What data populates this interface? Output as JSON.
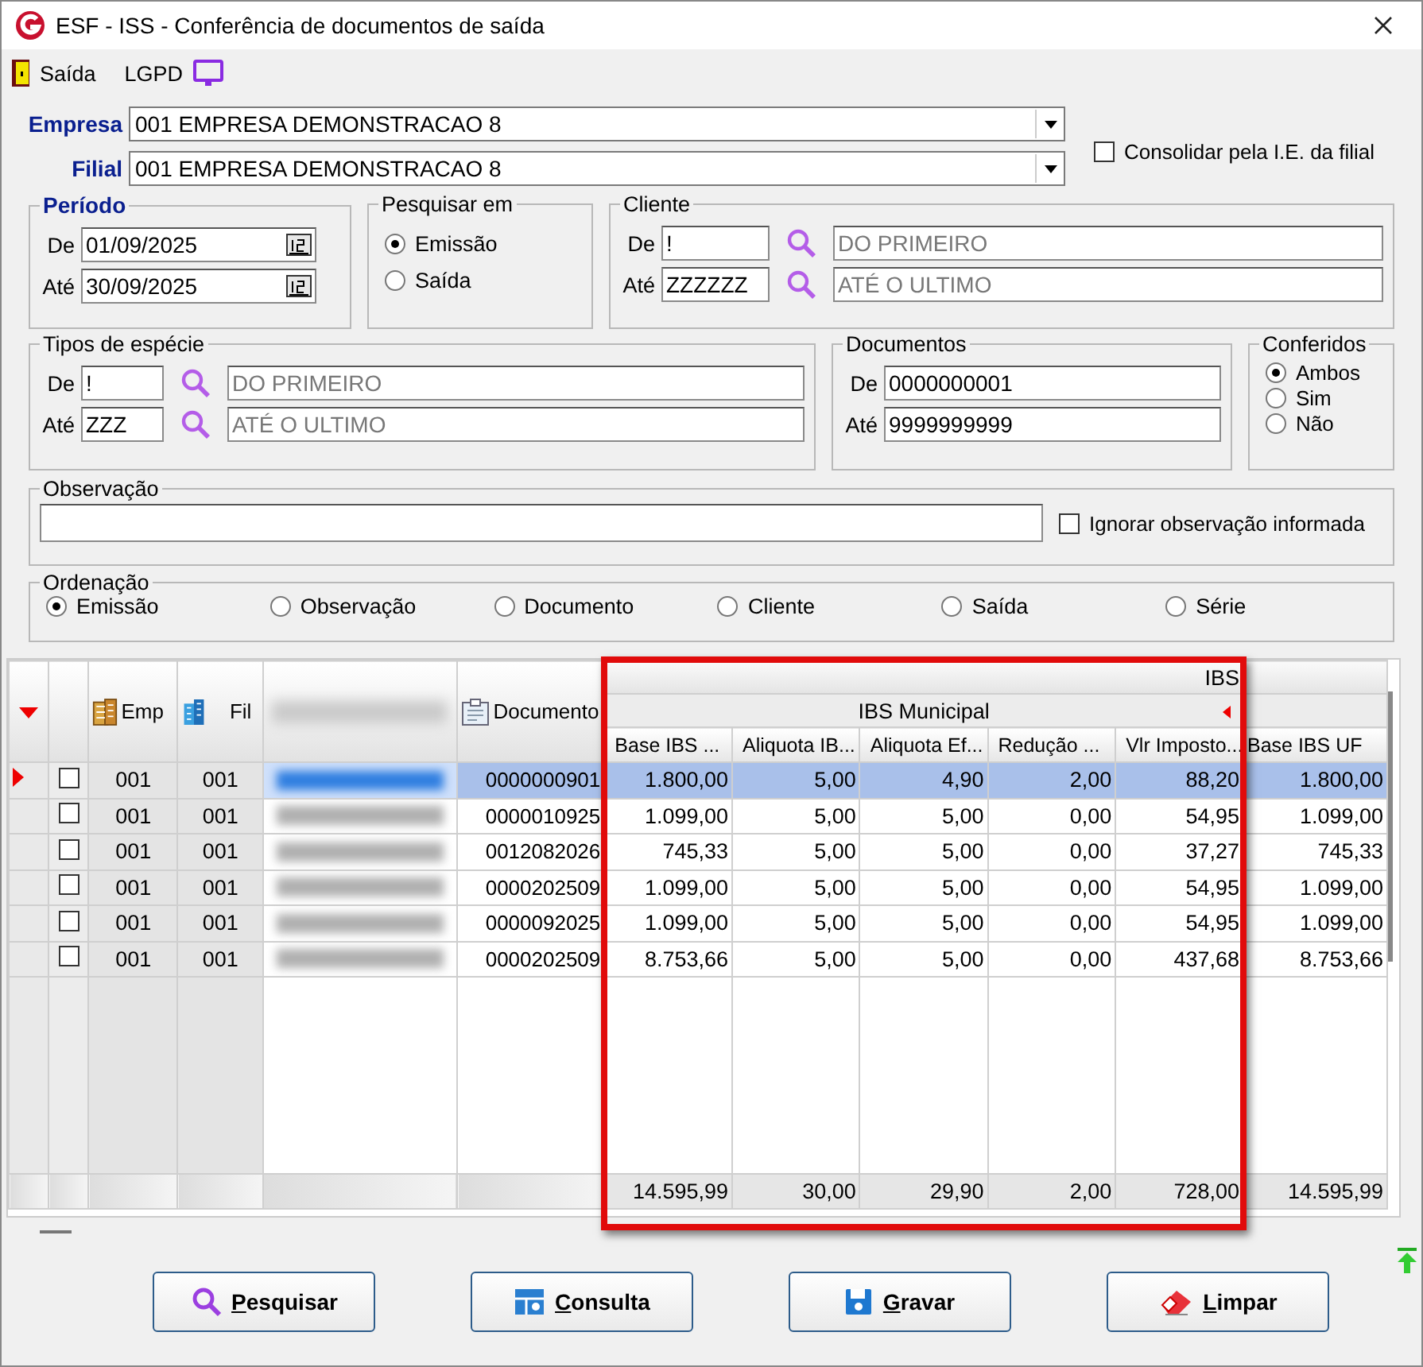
{
  "window": {
    "title": "ESF - ISS - Conferência de documentos de saída"
  },
  "toolbar": [
    {
      "kind": "exit",
      "label": "Saída"
    },
    {
      "kind": "lgpd",
      "label": "LGPD"
    }
  ],
  "empresa": {
    "label": "Empresa",
    "value": "001 EMPRESA DEMONSTRACAO 8"
  },
  "filial": {
    "label": "Filial",
    "value": "001 EMPRESA DEMONSTRACAO 8"
  },
  "consolidar": {
    "label": "Consolidar pela I.E. da filial",
    "checked": false
  },
  "periodo": {
    "title": "Período",
    "de": {
      "label": "De",
      "value": "01/09/2025"
    },
    "ate": {
      "label": "Até",
      "value": "30/09/2025"
    }
  },
  "pesquisar_em": {
    "title": "Pesquisar em",
    "options": [
      {
        "label": "Emissão",
        "selected": true
      },
      {
        "label": "Saída",
        "selected": false
      }
    ]
  },
  "cliente": {
    "title": "Cliente",
    "de": {
      "label": "De",
      "code": "!",
      "name": "DO PRIMEIRO"
    },
    "ate": {
      "label": "Até",
      "code": "ZZZZZZ",
      "name": "ATÉ O ULTIMO"
    }
  },
  "tipos_especie": {
    "title": "Tipos de espécie",
    "de": {
      "label": "De",
      "code": "!",
      "name": "DO PRIMEIRO"
    },
    "ate": {
      "label": "Até",
      "code": "ZZZ",
      "name": "ATÉ O ULTIMO"
    }
  },
  "documentos": {
    "title": "Documentos",
    "de": {
      "label": "De",
      "value": "0000000001"
    },
    "ate": {
      "label": "Até",
      "value": "9999999999"
    }
  },
  "conferidos": {
    "title": "Conferidos",
    "options": [
      {
        "label": "Ambos",
        "selected": true
      },
      {
        "label": "Sim",
        "selected": false
      },
      {
        "label": "Não",
        "selected": false
      }
    ]
  },
  "observacao": {
    "title": "Observação",
    "ignorar": {
      "label": "Ignorar observação informada",
      "checked": false
    }
  },
  "ordenacao": {
    "title": "Ordenação",
    "options": [
      {
        "label": "Emissão",
        "selected": true
      },
      {
        "label": "Observação",
        "selected": false
      },
      {
        "label": "Documento",
        "selected": false
      },
      {
        "label": "Cliente",
        "selected": false
      },
      {
        "label": "Saída",
        "selected": false
      },
      {
        "label": "Série",
        "selected": false
      }
    ]
  },
  "grid": {
    "columns": [
      "Emp",
      "Fil",
      "Documento"
    ],
    "group": "IBS",
    "subgroup": "IBS Municipal",
    "value_columns": [
      "Base IBS ...",
      "Aliquota IB...",
      "Aliquota Ef...",
      "Redução ...",
      "Vlr Imposto...",
      "Base IBS UF"
    ],
    "rows": [
      {
        "selected": true,
        "checked": false,
        "emp": "001",
        "fil": "001",
        "documento": "0000000901",
        "values": [
          "1.800,00",
          "5,00",
          "4,90",
          "2,00",
          "88,20",
          "1.800,00"
        ]
      },
      {
        "selected": false,
        "checked": false,
        "emp": "001",
        "fil": "001",
        "documento": "0000010925",
        "values": [
          "1.099,00",
          "5,00",
          "5,00",
          "0,00",
          "54,95",
          "1.099,00"
        ]
      },
      {
        "selected": false,
        "checked": false,
        "emp": "001",
        "fil": "001",
        "documento": "0012082026",
        "values": [
          "745,33",
          "5,00",
          "5,00",
          "0,00",
          "37,27",
          "745,33"
        ]
      },
      {
        "selected": false,
        "checked": false,
        "emp": "001",
        "fil": "001",
        "documento": "0000202509",
        "values": [
          "1.099,00",
          "5,00",
          "5,00",
          "0,00",
          "54,95",
          "1.099,00"
        ]
      },
      {
        "selected": false,
        "checked": false,
        "emp": "001",
        "fil": "001",
        "documento": "0000092025",
        "values": [
          "1.099,00",
          "5,00",
          "5,00",
          "0,00",
          "54,95",
          "1.099,00"
        ]
      },
      {
        "selected": false,
        "checked": false,
        "emp": "001",
        "fil": "001",
        "documento": "0000202509",
        "values": [
          "8.753,66",
          "5,00",
          "5,00",
          "0,00",
          "437,68",
          "8.753,66"
        ]
      }
    ],
    "totals": [
      "14.595,99",
      "30,00",
      "29,90",
      "2,00",
      "728,00",
      "14.595,99"
    ]
  },
  "buttons": [
    {
      "kind": "search",
      "label": "Pesquisar"
    },
    {
      "kind": "query",
      "label": "Consulta"
    },
    {
      "kind": "save",
      "label": "Gravar"
    },
    {
      "kind": "clear",
      "label": "Limpar"
    }
  ]
}
